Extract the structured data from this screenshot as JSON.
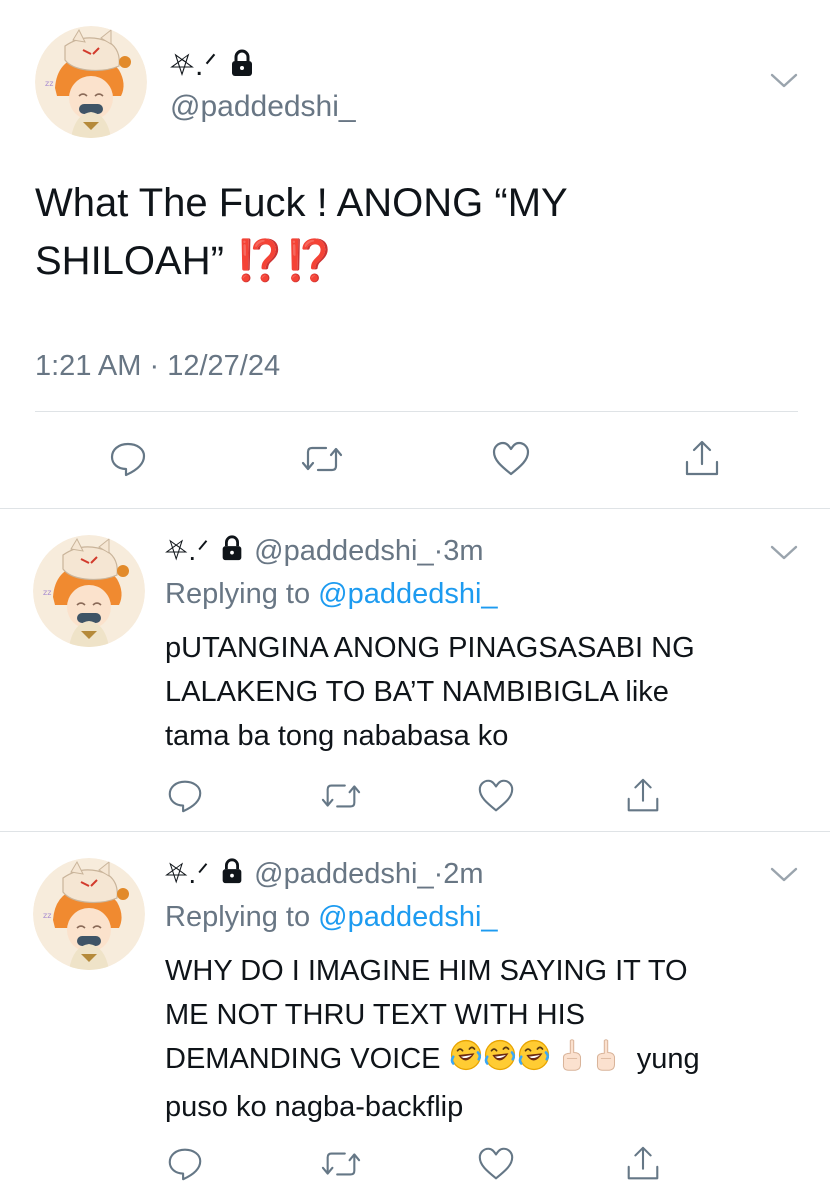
{
  "main_tweet": {
    "display_name": "⛧.ᐟ",
    "handle": "@paddedshi_",
    "text_line1": "What The Fuck ! ANONG “MY",
    "text_line2": "SHILOAH”",
    "text_emoji": "⁉️⁉️",
    "time": "1:21 AM",
    "dot": "·",
    "date": "12/27/24"
  },
  "replies": [
    {
      "display_name": "⛧.ᐟ",
      "handle": "@paddedshi_",
      "dot": "·",
      "age": "3m",
      "replying_prefix": "Replying to",
      "replying_handle": "@paddedshi_",
      "lines": [
        "pUTANGINA ANONG PINAGSASABI NG",
        "LALAKENG TO BA’T NAMBIBIGLA like",
        "tama ba tong nababasa ko"
      ]
    },
    {
      "display_name": "⛧.ᐟ",
      "handle": "@paddedshi_",
      "dot": "·",
      "age": "2m",
      "replying_prefix": "Replying to",
      "replying_handle": "@paddedshi_",
      "lines": [
        "WHY DO I IMAGINE HIM SAYING IT TO",
        "ME NOT THRU TEXT WITH HIS",
        "DEMANDING VOICE",
        "puso ko nagba-backflip"
      ],
      "line3_tail": "yung"
    }
  ],
  "icons": {
    "lock": "lock-icon",
    "chevron": "chevron-down-icon",
    "reply": "reply-icon",
    "retweet": "retweet-icon",
    "like": "heart-icon",
    "share": "share-icon",
    "laugh": "rolling-laughing-emoji",
    "finger": "middle-finger-emoji"
  },
  "colors": {
    "link": "#1d9bf0",
    "secondary": "#687684",
    "divider": "#dfe3e6",
    "emphasis": "#e0241a"
  }
}
